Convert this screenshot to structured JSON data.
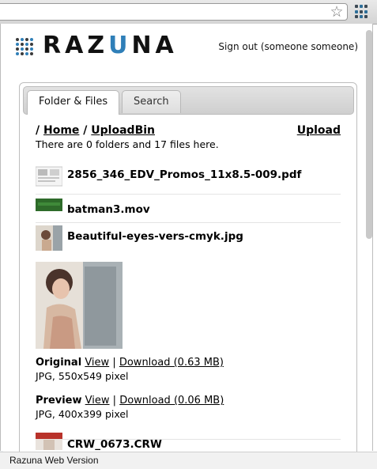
{
  "app": {
    "logo_text_part1": "RAZ",
    "logo_text_part2": "U",
    "logo_text_part3": "NA",
    "sign_out": "Sign out (someone someone)",
    "status_bar": "Razuna Web Version",
    "accent_color": "#2f7fb8"
  },
  "tabs": [
    {
      "label": "Folder & Files",
      "active": true
    },
    {
      "label": "Search",
      "active": false
    }
  ],
  "breadcrumb": {
    "separator": "/",
    "home": "Home",
    "folder": "UploadBin"
  },
  "upload_label": "Upload",
  "summary": "There are 0 folders and 17 files here.",
  "files": [
    {
      "name": "2856_346_EDV_Promos_11x8.5-009.pdf",
      "thumb_icon": "pdf-thumbnail"
    },
    {
      "name": "batman3.mov",
      "thumb_icon": "video-thumbnail"
    },
    {
      "name": "Beautiful-eyes-vers-cmyk.jpg",
      "thumb_icon": "image-thumbnail"
    },
    {
      "name": "CRW_0673.CRW",
      "thumb_icon": "image-thumbnail"
    }
  ],
  "selected_file": {
    "original": {
      "label": "Original",
      "view": "View",
      "separator": "|",
      "download": "Download (0.63 MB)",
      "meta": "JPG, 550x549 pixel"
    },
    "preview": {
      "label": "Preview",
      "view": "View",
      "separator": "|",
      "download": "Download (0.06 MB)",
      "meta": "JPG, 400x399 pixel"
    }
  }
}
